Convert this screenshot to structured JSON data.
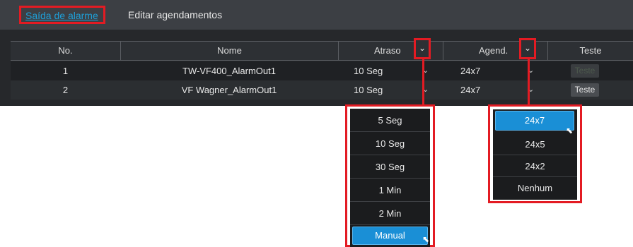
{
  "tabs": {
    "alarm_out": "Saída de alarme",
    "edit_schedules": "Editar agendamentos"
  },
  "table": {
    "headers": {
      "no": "No.",
      "name": "Nome",
      "delay": "Atraso",
      "schedule": "Agend.",
      "test": "Teste"
    },
    "rows": [
      {
        "no": "1",
        "name": "TW-VF400_AlarmOut1",
        "delay": "10 Seg",
        "schedule": "24x7",
        "test": "Teste",
        "test_enabled": false
      },
      {
        "no": "2",
        "name": "VF Wagner_AlarmOut1",
        "delay": "10 Seg",
        "schedule": "24x7",
        "test": "Teste",
        "test_enabled": true
      }
    ]
  },
  "delay_dropdown": {
    "options": [
      "5 Seg",
      "10 Seg",
      "30 Seg",
      "1 Min",
      "2 Min",
      "Manual"
    ],
    "selected": "Manual"
  },
  "schedule_dropdown": {
    "options": [
      "24x7",
      "24x5",
      "24x2",
      "Nenhum"
    ],
    "selected": "24x7"
  },
  "icons": {
    "chevron": "chevron-down-icon",
    "cursor": "mouse-pointer-icon"
  },
  "colors": {
    "highlight": "#e31b23",
    "accent": "#1a8fd6"
  }
}
